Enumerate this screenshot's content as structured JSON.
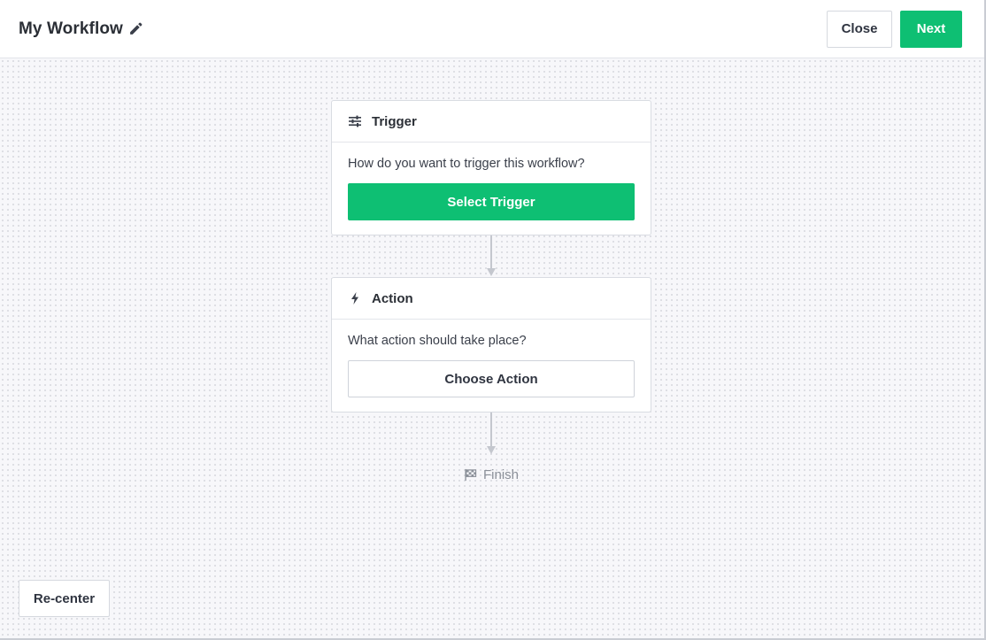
{
  "header": {
    "title": "My Workflow",
    "close_label": "Close",
    "next_label": "Next"
  },
  "trigger": {
    "title": "Trigger",
    "question": "How do you want to trigger this workflow?",
    "button_label": "Select Trigger",
    "icon": "sliders-icon"
  },
  "action": {
    "title": "Action",
    "question": "What action should take place?",
    "button_label": "Choose Action",
    "icon": "lightning-icon"
  },
  "finish": {
    "label": "Finish",
    "icon": "checkered-flag-icon"
  },
  "canvas": {
    "recenter_label": "Re-center"
  },
  "colors": {
    "accent": "#0ebf73",
    "text": "#2f3440",
    "muted": "#8b9099",
    "canvas_bg": "#f7f7fa"
  }
}
